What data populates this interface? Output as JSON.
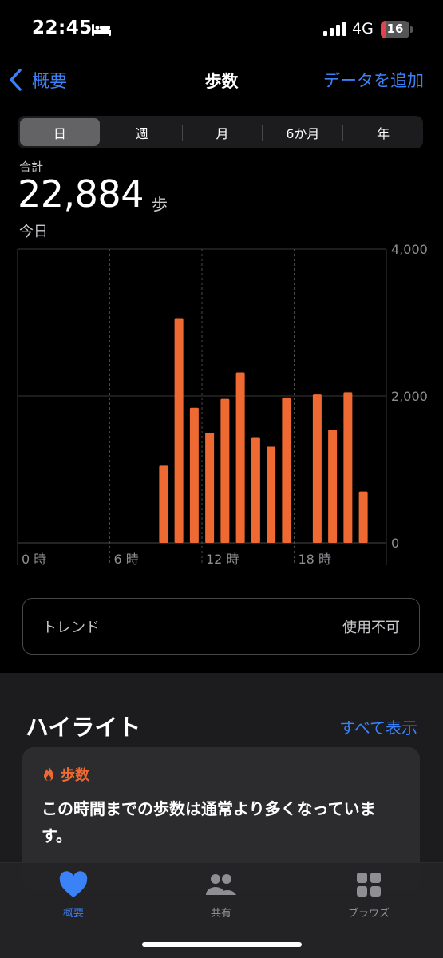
{
  "status_bar": {
    "time": "22:45",
    "network": "4G",
    "battery_level": "16",
    "battery_fraction": 0.16
  },
  "nav": {
    "back_label": "概要",
    "title": "歩数",
    "add_label": "データを追加"
  },
  "segments": [
    "日",
    "週",
    "月",
    "6か月",
    "年"
  ],
  "selected_segment": "日",
  "summary": {
    "label": "合計",
    "value": "22,884",
    "unit": "歩",
    "date": "今日"
  },
  "chart_data": {
    "type": "bar",
    "x_tick_labels": [
      "0 時",
      "6 時",
      "12 時",
      "18 時"
    ],
    "y_tick_labels": [
      "4,000",
      "2,000",
      "0"
    ],
    "ylim": [
      0,
      4000
    ],
    "hours": [
      0,
      1,
      2,
      3,
      4,
      5,
      6,
      7,
      8,
      9,
      10,
      11,
      12,
      13,
      14,
      15,
      16,
      17,
      18,
      19,
      20,
      21,
      22,
      23
    ],
    "values": [
      0,
      0,
      0,
      0,
      0,
      0,
      0,
      0,
      0,
      1050,
      3060,
      1840,
      1500,
      1960,
      2320,
      1430,
      1310,
      1980,
      0,
      2020,
      1540,
      2050,
      700,
      0
    ],
    "bar_color": "#ef6a32",
    "grid": true
  },
  "trend": {
    "label": "トレンド",
    "value": "使用不可"
  },
  "highlights": {
    "title": "ハイライト",
    "show_all": "すべて表示",
    "card": {
      "category": "歩数",
      "text": "この時間までの歩数は通常より多くなっています。"
    }
  },
  "tabs": [
    {
      "label": "概要",
      "icon": "heart-icon",
      "active": true
    },
    {
      "label": "共有",
      "icon": "people-icon",
      "active": false
    },
    {
      "label": "ブラウズ",
      "icon": "grid-icon",
      "active": false
    }
  ],
  "colors": {
    "accent": "#3b82f6",
    "steps": "#ef6a32",
    "inactive": "#8e8e93"
  }
}
